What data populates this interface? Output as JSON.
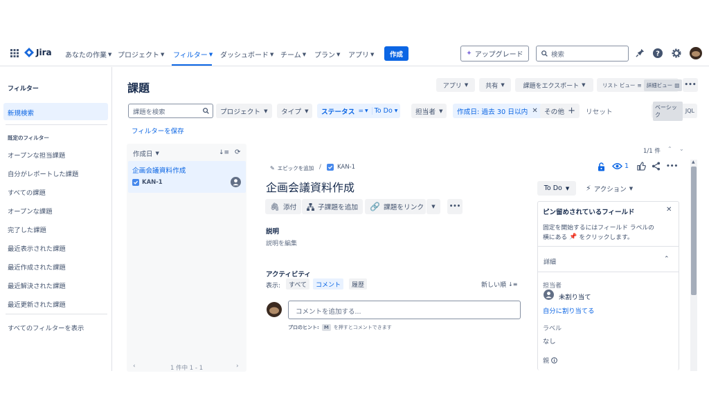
{
  "nav": {
    "logo": "Jira",
    "items": [
      "あなたの作業",
      "プロジェクト",
      "フィルター",
      "ダッシュボード",
      "チーム",
      "プラン",
      "アプリ"
    ],
    "create": "作成",
    "upgrade": "アップグレード",
    "search_placeholder": "検索"
  },
  "sidebar": {
    "title": "フィルター",
    "active": "新規検索",
    "section": "既定のフィルター",
    "items": [
      "オープンな担当課題",
      "自分がレポートした課題",
      "すべての課題",
      "オープンな課題",
      "完了した課題",
      "最近表示された課題",
      "最近作成された課題",
      "最近解決された課題",
      "最近更新された課題"
    ],
    "show_all": "すべてのフィルターを表示"
  },
  "page": {
    "title": "課題",
    "toolbar": {
      "apps": "アプリ",
      "share": "共有",
      "export": "課題をエクスポート",
      "list_view": "リスト ビュー",
      "detail_view": "詳細ビュー"
    }
  },
  "filters": {
    "search_placeholder": "課題を検索",
    "project": "プロジェクト",
    "type": "タイプ",
    "status_label": "ステータス",
    "status_op": "=",
    "status_value": "To Do",
    "assignee": "担当者",
    "created": "作成日: 過去 30 日以内",
    "more": "その他",
    "reset": "リセット",
    "basic": "ベーシック",
    "jql": "JQL",
    "save": "フィルターを保存"
  },
  "list": {
    "sort": "作成日",
    "item_title": "企画会議資料作成",
    "item_key": "KAN-1",
    "pagination": "1 件中 1 - 1"
  },
  "detail": {
    "count": "1/1 件",
    "add_epic": "エピックを追加",
    "breadcrumb_sep": "/",
    "key": "KAN-1",
    "watchers": "1",
    "title": "企画会議資料作成",
    "attach": "添付",
    "add_child": "子課題を追加",
    "link": "課題をリンク",
    "desc_label": "説明",
    "desc_placeholder": "説明を編集",
    "activity": "アクティビティ",
    "show": "表示:",
    "tabs": [
      "すべて",
      "コメント",
      "履歴"
    ],
    "newest": "新しい順",
    "comment_placeholder": "コメントを追加する...",
    "tip_prefix": "プロのヒント:",
    "tip_key": "M",
    "tip_suffix": "を押すとコメントできます"
  },
  "side": {
    "status": "To Do",
    "action": "アクション",
    "pinned_title": "ピン留めされているフィールド",
    "pinned_desc1": "固定を開始するにはフィールド ラベルの",
    "pinned_desc2": "横にある",
    "pinned_desc3": "をクリックします。",
    "details": "詳細",
    "assignee_label": "担当者",
    "unassigned": "未割り当て",
    "assign_me": "自分に割り当てる",
    "labels_label": "ラベル",
    "labels_value": "なし",
    "parent_label": "親"
  },
  "colors": {
    "accent": "#0c66e4",
    "selected_bg": "#e9f2ff",
    "text": "#172b4d",
    "muted": "#44546f"
  }
}
